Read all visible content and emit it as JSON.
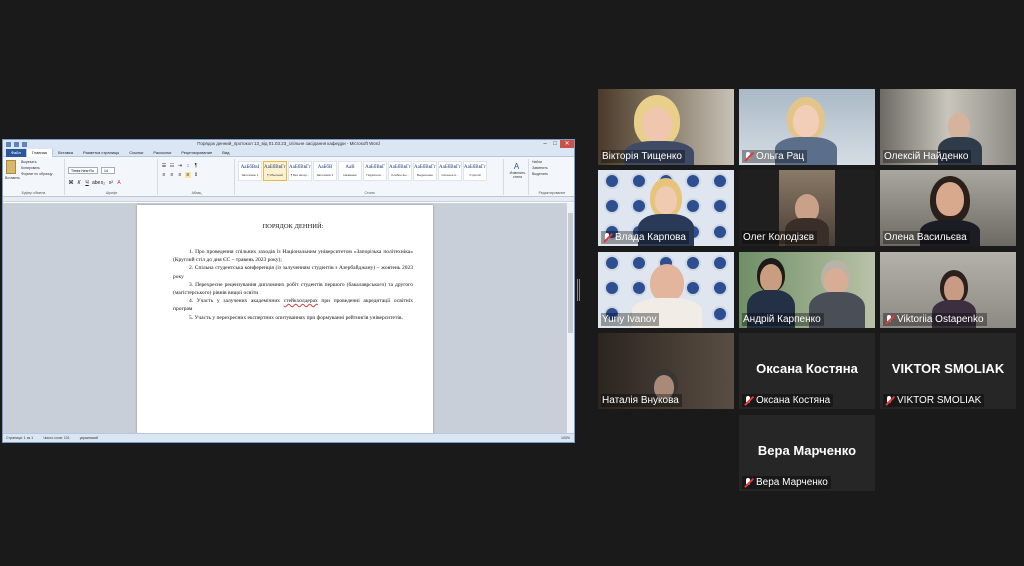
{
  "word": {
    "title": "Порядок денний_протокол 13_від 01.03.23_спільне засідання кафедри  -  Microsoft Word",
    "tabs": [
      "Файл",
      "Главная",
      "Вставка",
      "Разметка страницы",
      "Ссылки",
      "Рассылки",
      "Рецензирование",
      "Вид"
    ],
    "clipboard": {
      "paste": "Вставить",
      "cut": "Вырезать",
      "copy": "Копировать",
      "format": "Формат по образцу",
      "label": "Буфер обмена"
    },
    "font": {
      "name": "Times New Ro",
      "size": "14",
      "label": "Шрифт"
    },
    "paragraph_label": "Абзац",
    "styles_label": "Стили",
    "styles": [
      {
        "sample": "AaБбВвI",
        "name": "Заголовок 1"
      },
      {
        "sample": "AaБбВвГг",
        "name": "¶ Обычный"
      },
      {
        "sample": "AaБбВвГг",
        "name": "¶ Без интер..."
      },
      {
        "sample": "AaБбВ",
        "name": "Заголовок 2"
      },
      {
        "sample": "AaB",
        "name": "Название"
      },
      {
        "sample": "AaБбВвГ",
        "name": "Подзаголо..."
      },
      {
        "sample": "AaБбВвГг",
        "name": "Слабое вы..."
      },
      {
        "sample": "AaБбВвГг",
        "name": "Выделение"
      },
      {
        "sample": "AaБбВвГг",
        "name": "Сильное в..."
      },
      {
        "sample": "AaБбВвГг",
        "name": "Строгий"
      }
    ],
    "change_styles": "Изменить стили",
    "editing": {
      "find": "Найти",
      "replace": "Заменить",
      "select": "Выделить",
      "label": "Редактирование"
    },
    "status": {
      "page": "Страница: 1 из 1",
      "words": "Число слов: 101",
      "lang": "украинский",
      "zoom": "100%"
    },
    "doc": {
      "heading": "ПОРЯДОК ДЕННИЙ:",
      "p1": "1. Про проведення спільних заходів із Національним університетом «Запорізька політехніка» (Круглий стіл до дня ЄС – травень 2023 року);",
      "p2": "2. Спільна студентська конференція (із залученням студентів з Азербайджану) – жовтень 2023 року",
      "p3": "3. Перехресне рецензування дипломних робіт студентів першого (бакалаврського) та другого (магістерського) рівнів вищої освіти",
      "p4a": "4. Участь у залучених академічних ",
      "p4u": "стейкхолдерах",
      "p4b": " при проведенні акредитації освітніх програм",
      "p5": "5. Участь у перехресних експертних опитуваннях при формуванні рейтингів університетів."
    }
  },
  "participants": [
    {
      "name": "Вікторія Тищенко",
      "muted": false
    },
    {
      "name": "Ольга Рац",
      "muted": true
    },
    {
      "name": "Олексій Найденко",
      "muted": false
    },
    {
      "name": "Влада Карпова",
      "muted": true
    },
    {
      "name": "Олег Колодізєв",
      "muted": false
    },
    {
      "name": "Олена Васильєва",
      "muted": false
    },
    {
      "name": "Yuriy Ivanov",
      "muted": false
    },
    {
      "name": "Андрій Карпенко",
      "muted": false
    },
    {
      "name": "Viktoriia Ostapenko",
      "muted": true
    },
    {
      "name": "Наталія Внукова",
      "muted": false
    },
    {
      "name": "Оксана Костяна",
      "muted": true,
      "banner": "Оксана Костяна"
    },
    {
      "name": "VIKTOR SMOLIAK",
      "muted": true,
      "banner": "VIKTOR SMOLIAK"
    },
    {
      "name": "Вера Марченко",
      "muted": true,
      "banner": "Вера Марченко"
    }
  ],
  "colors": {
    "speaking_border": "#dfe86b",
    "muted_icon": "#e5383b",
    "word_blue": "#2b579a"
  }
}
